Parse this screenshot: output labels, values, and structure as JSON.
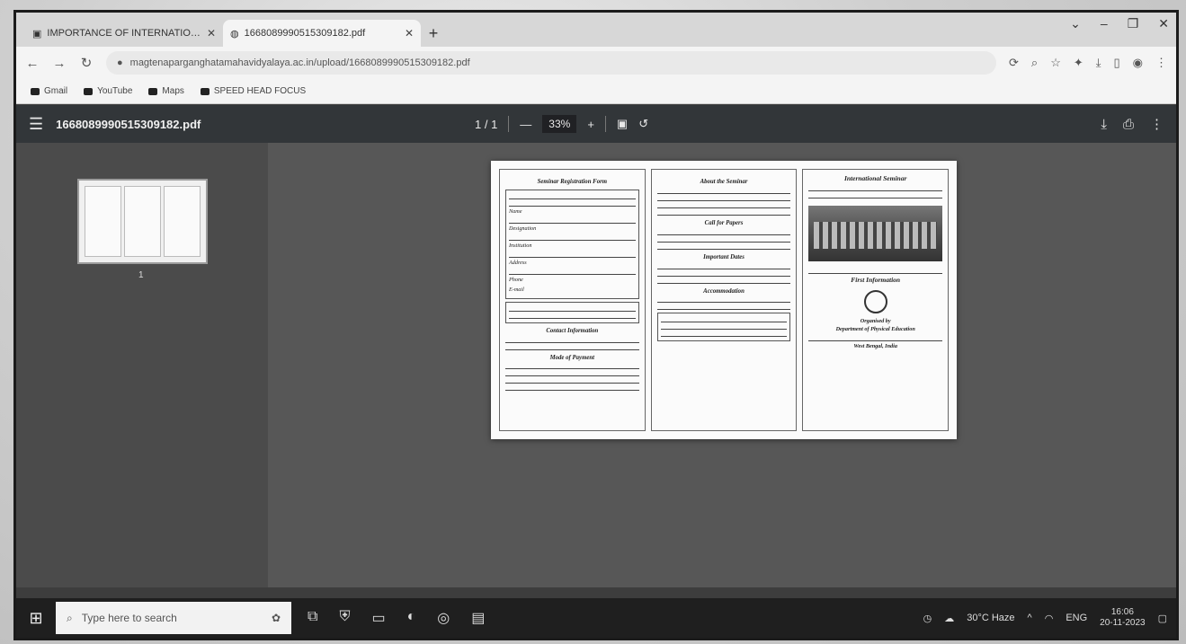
{
  "tabs": [
    {
      "label": "IMPORTANCE OF INTERNATIONAL",
      "icon": "page-favicon"
    },
    {
      "label": "1668089990515309182.pdf",
      "icon": "globe-icon"
    }
  ],
  "url": "magtenaparganghatamahavidyalaya.ac.in/upload/1668089990515309182.pdf",
  "bookmarks": [
    {
      "label": "Gmail"
    },
    {
      "label": "YouTube"
    },
    {
      "label": "Maps"
    },
    {
      "label": "SPEED HEAD FOCUS"
    }
  ],
  "pdf": {
    "title": "1668089990515309182.pdf",
    "page_indicator": "1 / 1",
    "zoom": "33%"
  },
  "sidebar": {
    "thumb_page_number": "1"
  },
  "brochure": {
    "left": {
      "heading1": "Seminar Registration Form",
      "fields": [
        "Name",
        "Designation",
        "Institution",
        "Address",
        "Phone",
        "E-mail"
      ],
      "heading2": "Contact Information",
      "heading3": "Mode of Payment"
    },
    "middle": {
      "heading1": "About the Seminar",
      "heading2": "Call for Papers",
      "heading3": "Important Dates",
      "heading4": "Accommodation"
    },
    "right": {
      "title": "International Seminar",
      "subtitle": "First Information",
      "organised_by": "Organised by",
      "department": "Department of Physical Education",
      "place": "West Bengal, India"
    }
  },
  "taskbar": {
    "search_placeholder": "Type here to search",
    "weather": "30°C Haze",
    "language": "ENG",
    "time": "16:06",
    "date": "20-11-2023"
  }
}
